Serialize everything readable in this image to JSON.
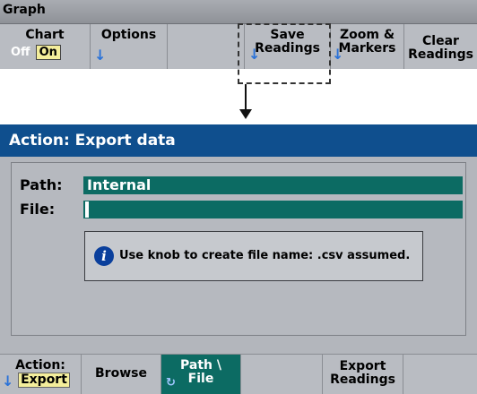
{
  "top_menu": {
    "title": "Graph",
    "keys": {
      "chart": {
        "label": "Chart",
        "off": "Off",
        "on": "On"
      },
      "options": {
        "label": "Options"
      },
      "save": {
        "line1": "Save",
        "line2": "Readings"
      },
      "zoom": {
        "line1": "Zoom &",
        "line2": "Markers"
      },
      "clear": {
        "line1": "Clear",
        "line2": "Readings"
      }
    }
  },
  "dialog": {
    "title": "Action: Export data",
    "path_label": "Path:",
    "path_value": "Internal",
    "file_label": "File:",
    "file_value": "",
    "message": "Use knob to create file name: .csv assumed."
  },
  "bottom_menu": {
    "action_label": "Action:",
    "action_value": "Export",
    "browse": "Browse",
    "path_file_line1": "Path \\",
    "path_file_line2": "File",
    "export_line1": "Export",
    "export_line2": "Readings"
  },
  "colors": {
    "title_bar": "#0f4f8e",
    "field_teal": "#0c6b63",
    "softkey_gray": "#b9bcc2",
    "selection_yellow": "#f4ee9b",
    "arrow_blue": "#2a72d8"
  },
  "icons": {
    "info": "info-icon",
    "down_arrow": "down-arrow-icon",
    "refresh": "refresh-icon"
  }
}
